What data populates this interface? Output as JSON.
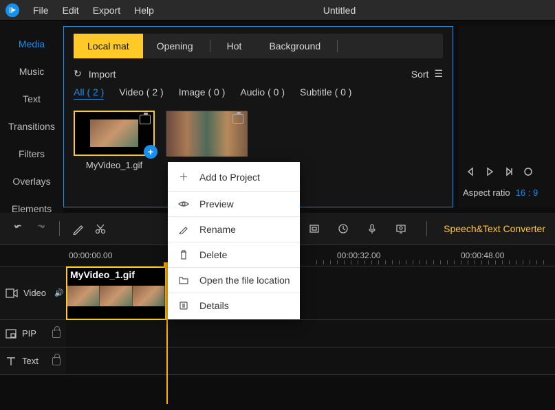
{
  "titlebar": {
    "menus": [
      "File",
      "Edit",
      "Export",
      "Help"
    ],
    "title": "Untitled"
  },
  "left_nav": [
    "Media",
    "Music",
    "Text",
    "Transitions",
    "Filters",
    "Overlays",
    "Elements"
  ],
  "media": {
    "tabs": [
      "Local mat",
      "Opening",
      "Hot",
      "Background"
    ],
    "import_label": "Import",
    "sort_label": "Sort",
    "filters": [
      "All ( 2 )",
      "Video ( 2 )",
      "Image ( 0 )",
      "Audio ( 0 )",
      "Subtitle ( 0 )"
    ],
    "thumb1_label": "MyVideo_1.gif"
  },
  "transport": {
    "aspect_label": "Aspect ratio",
    "aspect_value": "16 : 9"
  },
  "toolbar": {
    "stc": "Speech&Text Converter"
  },
  "ruler": [
    "00:00:00.00",
    "00:00:32.00",
    "00:00:48.00"
  ],
  "tracks": {
    "video": "Video",
    "pip": "PIP",
    "text": "Text"
  },
  "clip": {
    "label": "MyVideo_1.gif"
  },
  "context": {
    "add": "Add to Project",
    "preview": "Preview",
    "rename": "Rename",
    "delete": "Delete",
    "open": "Open the file location",
    "details": "Details"
  }
}
